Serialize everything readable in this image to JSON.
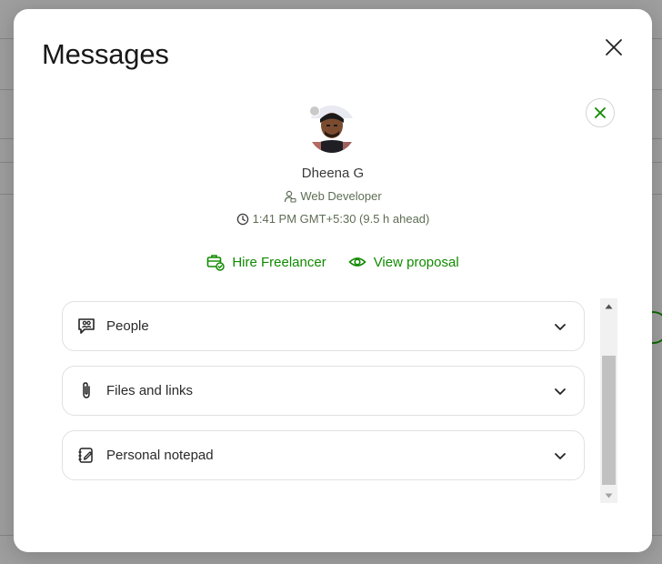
{
  "modal": {
    "title": "Messages"
  },
  "profile": {
    "name": "Dheena G",
    "role": "Web Developer",
    "local_time": "1:41 PM GMT+5:30 (9.5 h ahead)"
  },
  "actions": [
    {
      "label": "Hire Freelancer",
      "icon": "briefcase-check-icon"
    },
    {
      "label": "View proposal",
      "icon": "eye-icon"
    }
  ],
  "sections": [
    {
      "label": "People",
      "icon": "people-chat-icon"
    },
    {
      "label": "Files and links",
      "icon": "paperclip-icon"
    },
    {
      "label": "Personal notepad",
      "icon": "notepad-icon"
    }
  ],
  "colors": {
    "accent": "#108a00",
    "text": "#181818",
    "meta": "#5e6d55",
    "border": "#e1e1e1"
  }
}
